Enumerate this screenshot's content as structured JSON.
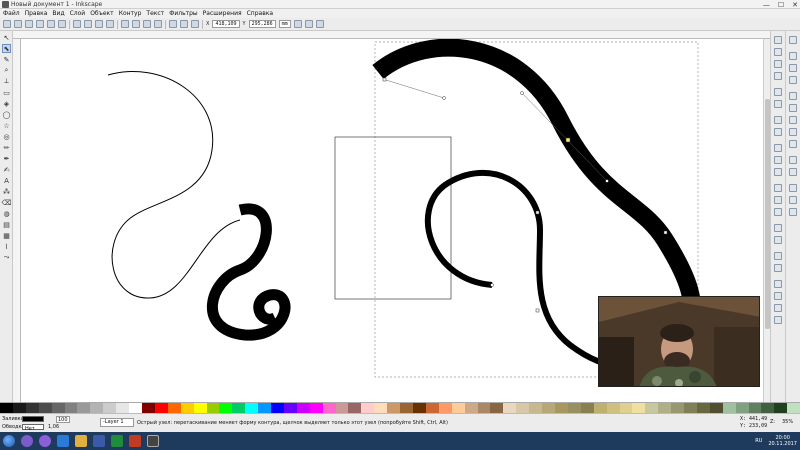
{
  "window": {
    "title": "Новый документ 1 - Inkscape",
    "controls": [
      "—",
      "☐",
      "✕"
    ]
  },
  "menu": [
    "Файл",
    "Правка",
    "Вид",
    "Слой",
    "Объект",
    "Контур",
    "Текст",
    "Фильтры",
    "Расширения",
    "Справка"
  ],
  "toolbar": {
    "x_label": "X",
    "x_value": "418,109",
    "y_label": "Y",
    "y_value": "295,286",
    "unit": "mm"
  },
  "status": {
    "fill_label": "Заливка:",
    "stroke_label": "Обводка:",
    "stroke_value": "Нет",
    "stroke_width": "1,06",
    "opacity_value": "100",
    "layer": "-Layer 1",
    "message": "Острый узел: перетаскивание меняет форму контура, щелчок выделяет только этот узел (попробуйте Shift, Ctrl, Alt)",
    "x_label": "X:",
    "x_value": "441,49",
    "y_label": "Y:",
    "y_value": "233,09",
    "zoom_label": "Z:",
    "zoom_value": "35%"
  },
  "taskbar": {
    "language": "RU",
    "time": "20:00",
    "date": "20.11.2017"
  },
  "palette_colors": [
    "#000000",
    "#1a1a1a",
    "#333333",
    "#4d4d4d",
    "#666666",
    "#808080",
    "#999999",
    "#b3b3b3",
    "#cccccc",
    "#e6e6e6",
    "#ffffff",
    "#800000",
    "#ff0000",
    "#ff6600",
    "#ffcc00",
    "#ffff00",
    "#99cc00",
    "#00ff00",
    "#00cc66",
    "#00ffff",
    "#0099ff",
    "#0000ff",
    "#6600ff",
    "#cc00ff",
    "#ff00ff",
    "#ff66cc",
    "#cc9999",
    "#996666",
    "#ffcccc",
    "#ffddbb",
    "#cc9966",
    "#996633",
    "#663300",
    "#cc6633",
    "#ff9966",
    "#ffcc99",
    "#ccaa88",
    "#aa8866",
    "#886644",
    "#e8d8c0",
    "#d8c8a8",
    "#c8b890",
    "#b8a878",
    "#a89860",
    "#989060",
    "#888050",
    "#c0b070",
    "#d0c080",
    "#e0d090",
    "#f0e0a0",
    "#c8c8a0",
    "#b0b088",
    "#989870",
    "#808058",
    "#686840",
    "#505030",
    "#a0c0a0",
    "#80a080",
    "#608060",
    "#406040",
    "#204020",
    "#c0e0c0"
  ]
}
